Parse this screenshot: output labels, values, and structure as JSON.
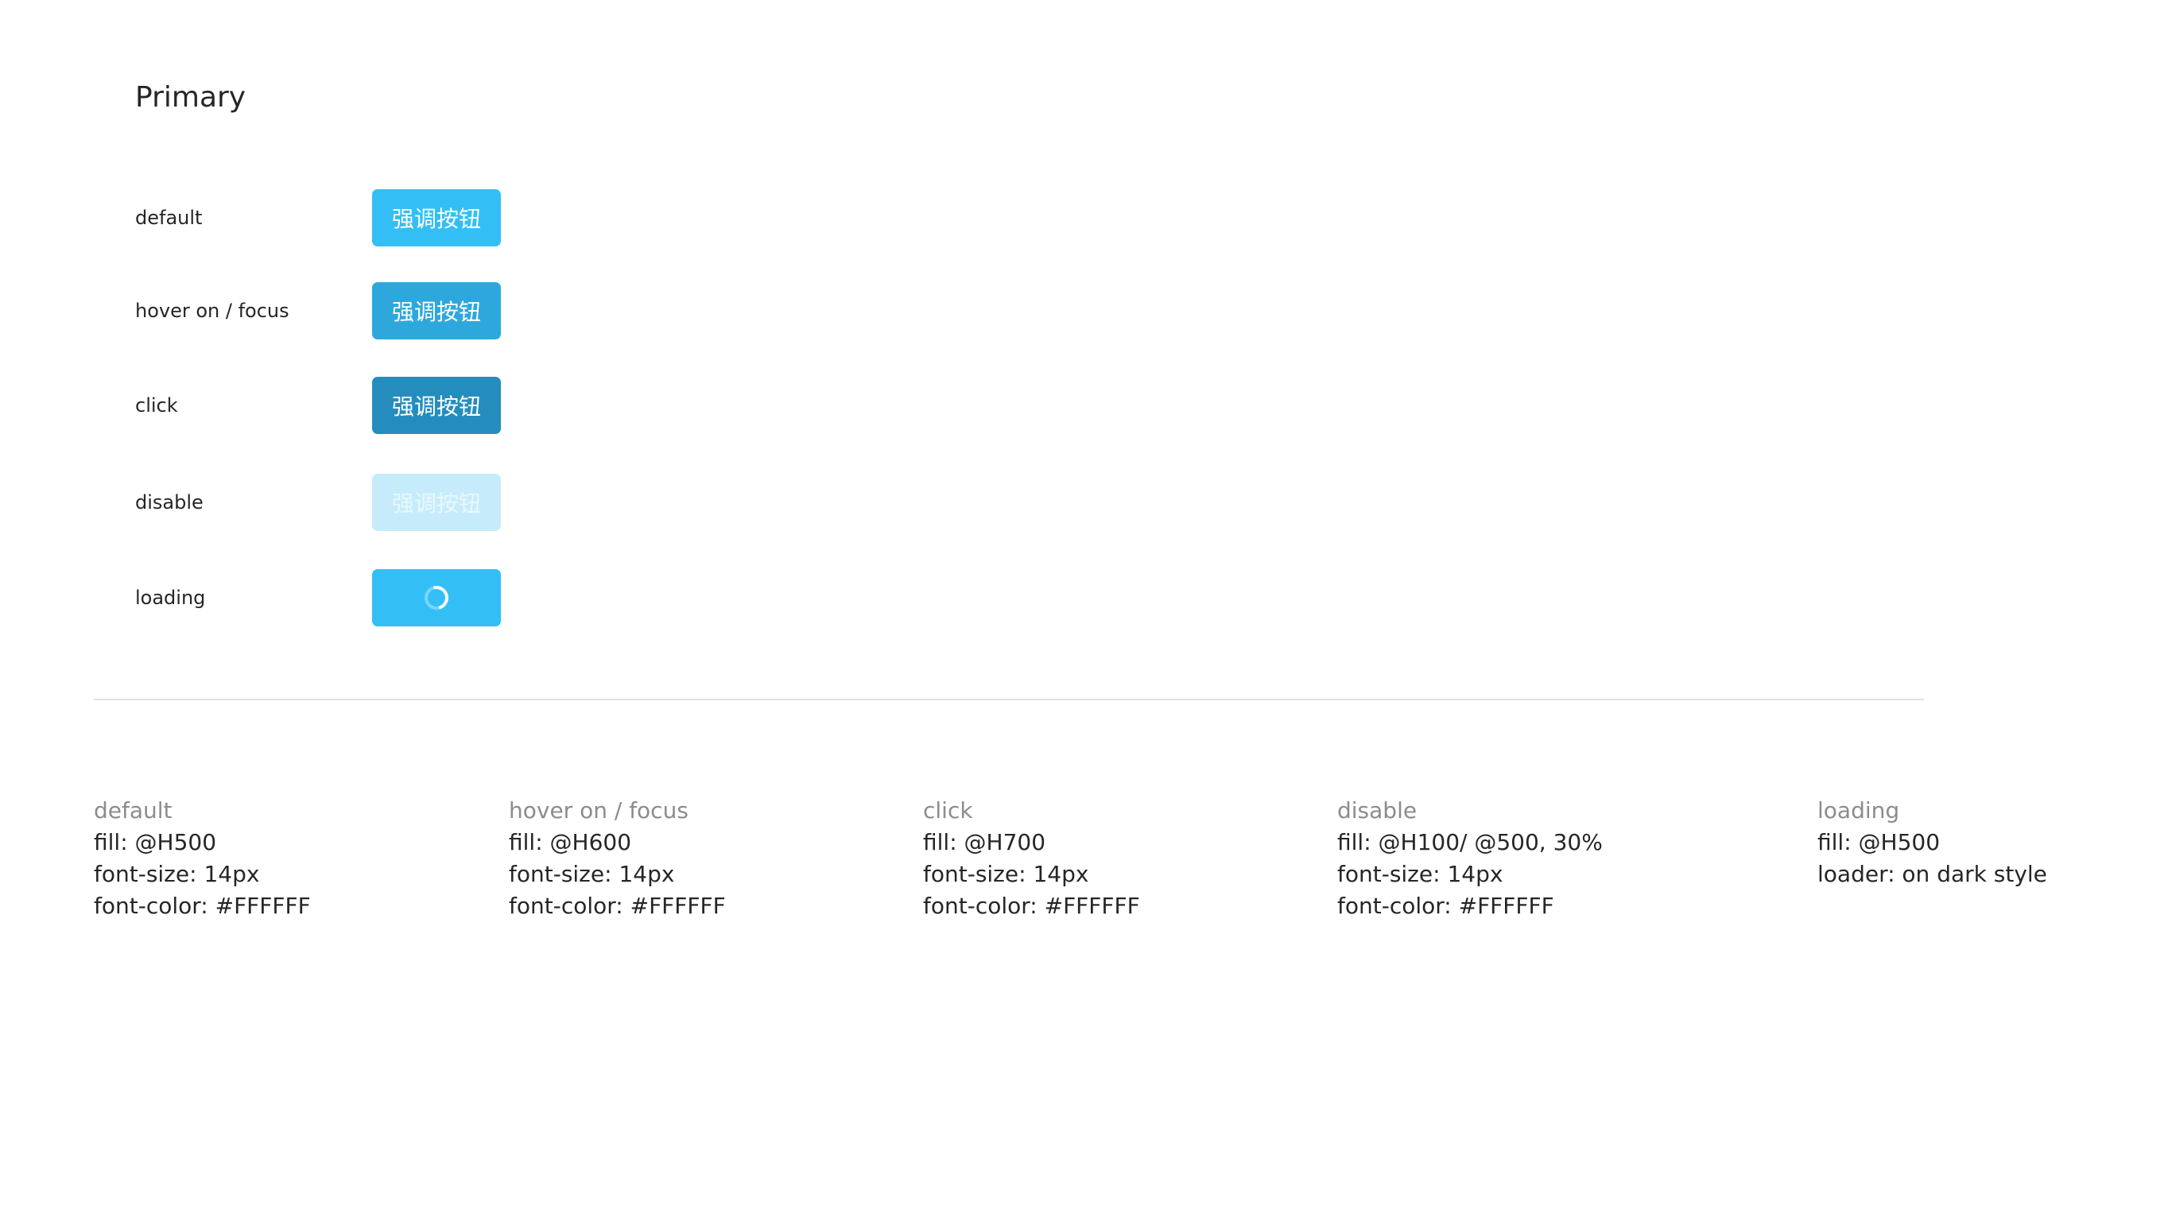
{
  "section_title": "Primary",
  "states": [
    {
      "label": "default",
      "button_text": "强调按钮"
    },
    {
      "label": "hover on / focus",
      "button_text": "强调按钮"
    },
    {
      "label": "click",
      "button_text": "强调按钮"
    },
    {
      "label": "disable",
      "button_text": "强调按钮"
    },
    {
      "label": "loading",
      "button_text": ""
    }
  ],
  "colors": {
    "default": "#33BFF5",
    "hover": "#2EA8DC",
    "click": "#258DBE",
    "disable": "#C6ECFC",
    "text": "#FFFFFF"
  },
  "loading_icon": "spinner-icon",
  "specs": [
    {
      "title": "default",
      "lines": [
        "fill: @H500",
        "font-size: 14px",
        "font-color: #FFFFFF"
      ]
    },
    {
      "title": "hover on / focus",
      "lines": [
        "fill: @H600",
        "font-size: 14px",
        "font-color: #FFFFFF"
      ]
    },
    {
      "title": "click",
      "lines": [
        "fill: @H700",
        "font-size: 14px",
        "font-color: #FFFFFF"
      ]
    },
    {
      "title": "disable",
      "lines": [
        "fill: @H100/ @500, 30%",
        "font-size: 14px",
        "font-color: #FFFFFF"
      ]
    },
    {
      "title": "loading",
      "lines": [
        "fill: @H500",
        "loader: on dark style"
      ]
    }
  ]
}
